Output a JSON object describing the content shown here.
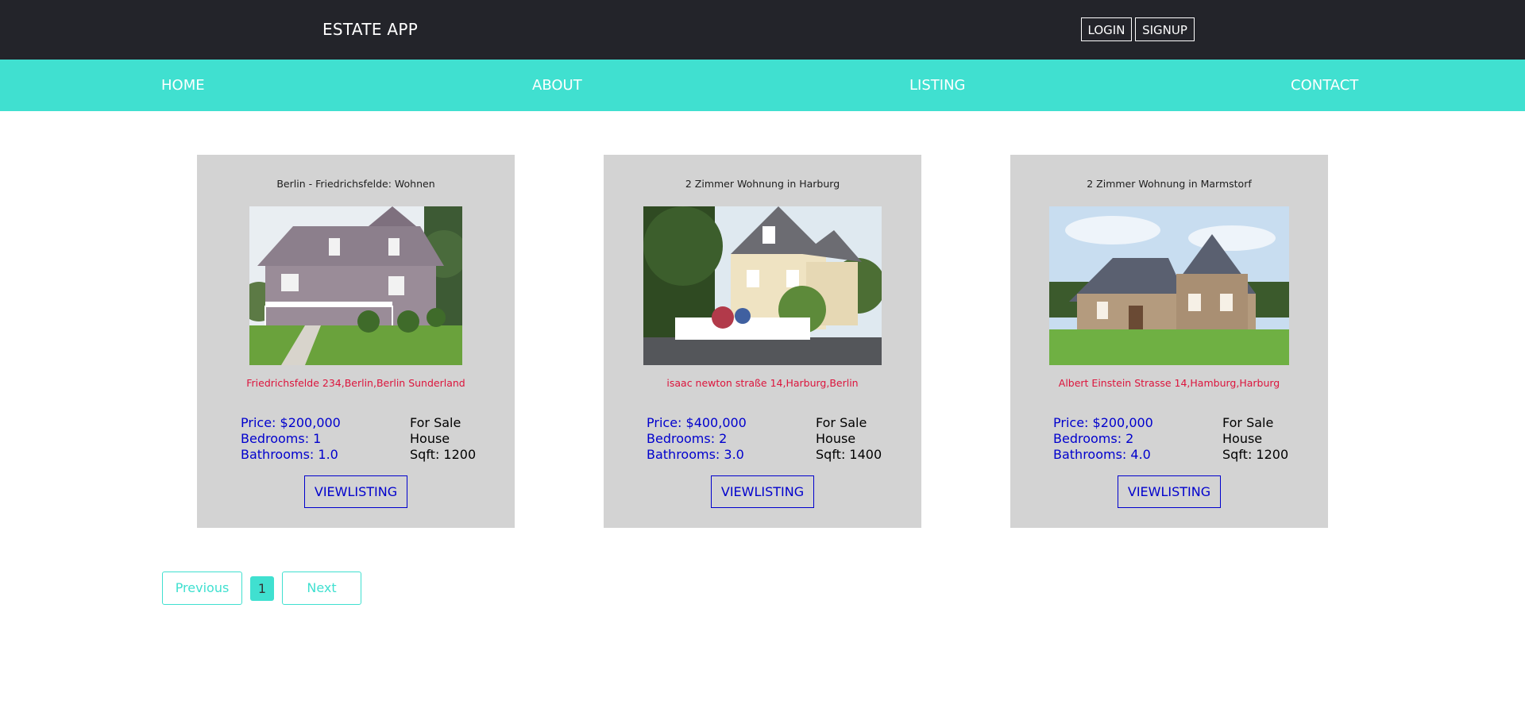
{
  "header": {
    "brand": "ESTATE APP",
    "login_label": "LOGIN",
    "signup_label": "SIGNUP"
  },
  "nav": {
    "items": [
      {
        "label": "HOME"
      },
      {
        "label": "ABOUT"
      },
      {
        "label": "LISTING"
      },
      {
        "label": "CONTACT"
      }
    ]
  },
  "listings": [
    {
      "title": "Berlin - Friedrichsfelde: Wohnen",
      "address": "Friedrichsfelde 234,Berlin,Berlin Sunderland",
      "price": "Price: $200,000",
      "bedrooms": "Bedrooms: 1",
      "bathrooms": "Bathrooms: 1.0",
      "sale_type": "For Sale",
      "home_type": "House",
      "sqft": "Sqft: 1200",
      "button_label": "VIEWLISTING"
    },
    {
      "title": "2 Zimmer Wohnung in Harburg",
      "address": "isaac newton straße 14,Harburg,Berlin",
      "price": "Price: $400,000",
      "bedrooms": "Bedrooms: 2",
      "bathrooms": "Bathrooms: 3.0",
      "sale_type": "For Sale",
      "home_type": "House",
      "sqft": "Sqft: 1400",
      "button_label": "VIEWLISTING"
    },
    {
      "title": "2 Zimmer Wohnung in Marmstorf",
      "address": "Albert Einstein Strasse 14,Hamburg,Harburg",
      "price": "Price: $200,000",
      "bedrooms": "Bedrooms: 2",
      "bathrooms": "Bathrooms: 4.0",
      "sale_type": "For Sale",
      "home_type": "House",
      "sqft": "Sqft: 1200",
      "button_label": "VIEWLISTING"
    }
  ],
  "pagination": {
    "previous_label": "Previous",
    "current_page": "1",
    "next_label": "Next"
  },
  "colors": {
    "topbar": "#23242a",
    "accent": "#40e0d0",
    "card_bg": "#d3d3d3",
    "address": "#dc143c",
    "info": "#0000cd"
  }
}
